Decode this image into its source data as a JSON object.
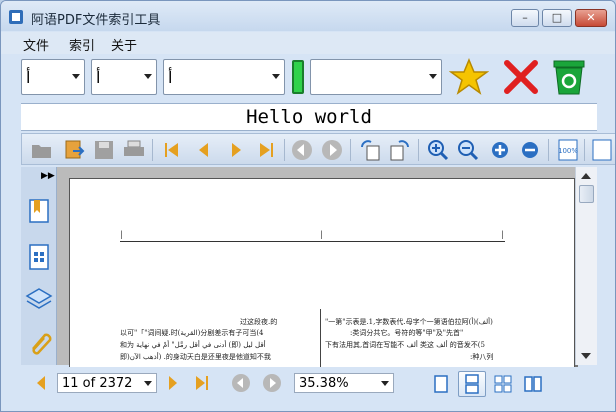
{
  "window": {
    "title": "阿语PDF文件索引工具"
  },
  "menu": {
    "items": [
      "文件",
      "索引",
      "关于"
    ]
  },
  "toolbar1": {
    "combo1": "أ",
    "combo2": "أ",
    "combo3": "أ",
    "combo4": "",
    "icons": [
      "star-icon",
      "close-x-icon",
      "recycle-bin-icon"
    ]
  },
  "heading": "Hello world",
  "toolbar2": {
    "icons": [
      "open-folder-icon",
      "export-icon",
      "save-icon",
      "print-icon",
      "first-page-icon",
      "prev-page-icon",
      "next-page-icon",
      "last-page-icon",
      "back-icon",
      "forward-icon",
      "rotate-cw-icon",
      "rotate-ccw-icon",
      "zoom-in-icon",
      "zoom-out-icon",
      "zoom-plus-icon",
      "zoom-minus-icon",
      "actual-size-icon"
    ],
    "actual_size_label": "100%"
  },
  "sidebar": {
    "icons": [
      "bookmark-icon",
      "page-thumbnails-icon",
      "layers-icon",
      "attachment-icon"
    ]
  },
  "document": {
    "header_marks": [
      "|",
      "|",
      "|"
    ],
    "left_col": [
      "过这段夜.的",
      "以可\"「\"词间疑.时(القرية)分剧差示有子可当(4",
      "和为 أدنى في أقل رمَّل\" أمْ في نهاية (即) أقل ليل",
      "即)أذهب الآن) .的身动天白是还里夜是他道知不我"
    ],
    "right_col": [
      "\"一第\"示表是.1,字数表代.母字个一第语伯拉阿(أ)(ألف)",
      ":类词分共它。号符的等\"甲\"及\"先首\"",
      "下有法用其,首词在写能不 ألف 类这 ألف 的音发不(5",
      ":种八列"
    ]
  },
  "status": {
    "page": "11 of 2372",
    "zoom": "35.38%",
    "view_modes": [
      "single-page-icon",
      "continuous-icon",
      "two-page-icon",
      "two-page-continuous-icon"
    ]
  },
  "colors": {
    "accent": "#2f6db8",
    "indicator": "#2fd24a",
    "star": "#f5c400",
    "close_x": "#e02020",
    "recycle": "#1aa53a"
  }
}
